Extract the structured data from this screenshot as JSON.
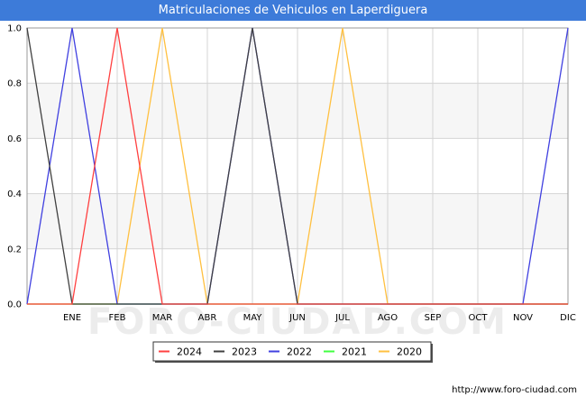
{
  "header": {
    "title": "Matriculaciones de Vehiculos en Laperdiguera"
  },
  "watermark": "FORO-CIUDAD.COM",
  "footer": {
    "credit": "http://www.foro-ciudad.com"
  },
  "colors": {
    "title_bg": "#3d7bd9",
    "band": "#f6f6f6",
    "grid": "#d4d4d4"
  },
  "chart_data": {
    "type": "line",
    "title": "Matriculaciones de Vehiculos en Laperdiguera",
    "xlabel": "",
    "ylabel": "",
    "categories": [
      "",
      "ENE",
      "FEB",
      "MAR",
      "ABR",
      "MAY",
      "JUN",
      "JUL",
      "AGO",
      "SEP",
      "OCT",
      "NOV",
      "DIC"
    ],
    "ylim": [
      0,
      1
    ],
    "yticks": [
      "0.0",
      "0.2",
      "0.4",
      "0.6",
      "0.8",
      "1.0"
    ],
    "grid": true,
    "legend_position": "bottom-center",
    "series": [
      {
        "name": "2020",
        "color": "#ffc040",
        "values": [
          0,
          0,
          0,
          1,
          0,
          0,
          0,
          1,
          0,
          0,
          0,
          0,
          0
        ]
      },
      {
        "name": "2021",
        "color": "#40ff40",
        "values": [
          0,
          0,
          0,
          0,
          0,
          0,
          0,
          0,
          0,
          0,
          0,
          0,
          0
        ]
      },
      {
        "name": "2022",
        "color": "#4040e0",
        "values": [
          0,
          1,
          0,
          0,
          0,
          1,
          0,
          0,
          0,
          0,
          0,
          0,
          1
        ]
      },
      {
        "name": "2023",
        "color": "#404040",
        "values": [
          1,
          0,
          0,
          0,
          0,
          1,
          0,
          0,
          0,
          0,
          0,
          0,
          0
        ]
      },
      {
        "name": "2024",
        "color": "#ff4040",
        "values": [
          0,
          0,
          1,
          0,
          0,
          0,
          0,
          0,
          0,
          0,
          0,
          0,
          0
        ]
      }
    ],
    "legend_order": [
      "2024",
      "2023",
      "2022",
      "2021",
      "2020"
    ]
  }
}
